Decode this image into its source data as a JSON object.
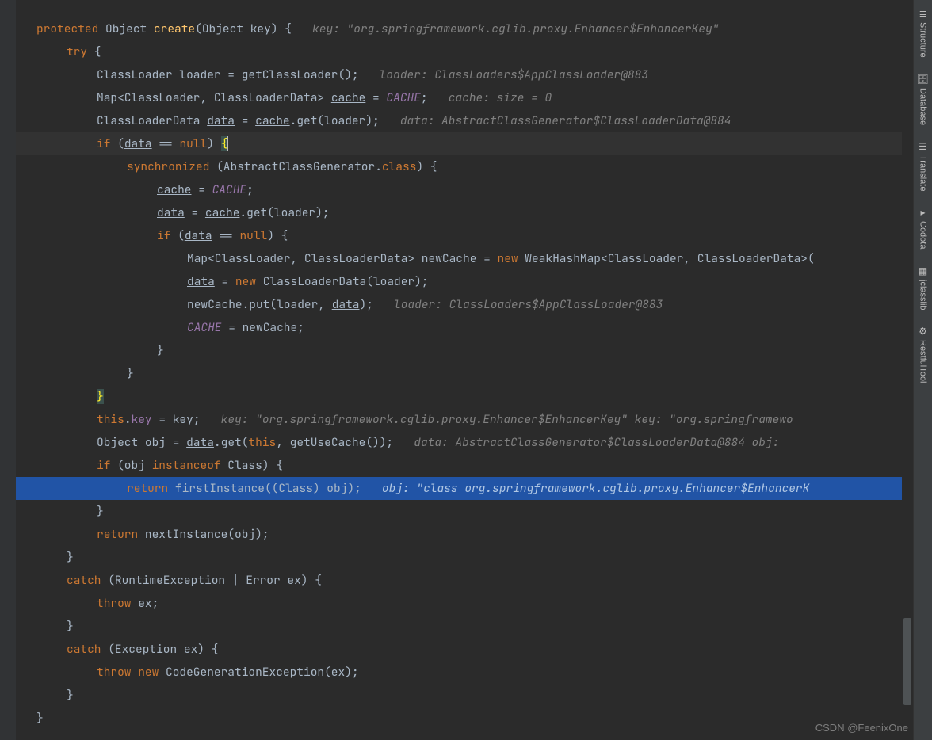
{
  "code": {
    "l1": {
      "kw1": "protected",
      "type1": "Object",
      "method": "create",
      "args": "(Object key) {",
      "comment": "key: \"org.springframework.cglib.proxy.Enhancer$EnhancerKey\""
    },
    "l2": {
      "kw": "try",
      "brace": " {"
    },
    "l3": {
      "a": "ClassLoader loader = getClassLoader();",
      "comment": "loader: ClassLoaders$AppClassLoader@883"
    },
    "l4": {
      "a": "Map<ClassLoader, ClassLoaderData> ",
      "u": "cache",
      "b": " = ",
      "c": "CACHE",
      "d": ";",
      "comment": "cache:  size = 0"
    },
    "l5": {
      "a": "ClassLoaderData ",
      "u1": "data",
      "b": " = ",
      "u2": "cache",
      "c": ".get(loader);",
      "comment": "data: AbstractClassGenerator$ClassLoaderData@884"
    },
    "l6": {
      "kw": "if",
      "a": " (",
      "u": "data",
      "b": " == ",
      "c": "null",
      "d": ") ",
      "brace": "{"
    },
    "l7": {
      "kw": "synchronized",
      "a": " (AbstractClassGenerator.",
      "b": "class",
      "c": ") {"
    },
    "l8": {
      "u": "cache",
      "a": " = ",
      "c": "CACHE",
      "d": ";"
    },
    "l9": {
      "u1": "data",
      "a": " = ",
      "u2": "cache",
      "b": ".get(loader);"
    },
    "l10": {
      "kw": "if",
      "a": " (",
      "u": "data",
      "b": " == ",
      "c": "null",
      "d": ") {"
    },
    "l11": {
      "a": "Map<ClassLoader, ClassLoaderData> newCache = ",
      "kw": "new",
      "b": " WeakHashMap<ClassLoader, ClassLoaderData>("
    },
    "l12": {
      "u": "data",
      "a": " = ",
      "kw": "new",
      "b": " ClassLoaderData(loader);"
    },
    "l13": {
      "a": "newCache.put(loader, ",
      "u": "data",
      "b": ");",
      "comment": "loader: ClassLoaders$AppClassLoader@883"
    },
    "l14": {
      "c": "CACHE",
      "a": " = newCache;"
    },
    "l15": {
      "a": "}"
    },
    "l16": {
      "a": "}"
    },
    "l17": {
      "a": "}"
    },
    "l18": {
      "kw": "this",
      "a": ".",
      "f": "key",
      "b": " = key;",
      "comment": "key: \"org.springframework.cglib.proxy.Enhancer$EnhancerKey\"   key: \"org.springframewo"
    },
    "l19": {
      "a": "Object obj = ",
      "u": "data",
      "b": ".get(",
      "kw": "this",
      "c": ", getUseCache());",
      "comment": "data: AbstractClassGenerator$ClassLoaderData@884   obj: "
    },
    "l20": {
      "kw": "if",
      "a": " (obj ",
      "kw2": "instanceof",
      "b": " Class) {"
    },
    "l21": {
      "kw": "return",
      "a": " firstInstance((Class) obj);",
      "comment": "obj: \"class org.springframework.cglib.proxy.Enhancer$EnhancerK"
    },
    "l22": {
      "a": "}"
    },
    "l23": {
      "kw": "return",
      "a": " nextInstance(obj);"
    },
    "l24": {
      "a": "}"
    },
    "l25": {
      "kw": "catch",
      "a": " (RuntimeException | Error ex) {"
    },
    "l26": {
      "kw": "throw",
      "a": " ex;"
    },
    "l27": {
      "a": "}"
    },
    "l28": {
      "kw": "catch",
      "a": " (Exception ex) {"
    },
    "l29": {
      "kw": "throw",
      "kw2": " new",
      "a": " CodeGenerationException(ex);"
    },
    "l30": {
      "a": "}"
    },
    "l31": {
      "a": "}"
    }
  },
  "sidebar": {
    "items": [
      {
        "label": "Structure",
        "icon": "≣"
      },
      {
        "label": "Database",
        "icon": "🗄"
      },
      {
        "label": "Translate",
        "icon": "☰"
      },
      {
        "label": "Codota",
        "icon": "▸"
      },
      {
        "label": "jclasslib",
        "icon": "▦"
      },
      {
        "label": "RestfulTool",
        "icon": "⚙"
      }
    ]
  },
  "watermark": "CSDN @FeenixOne"
}
